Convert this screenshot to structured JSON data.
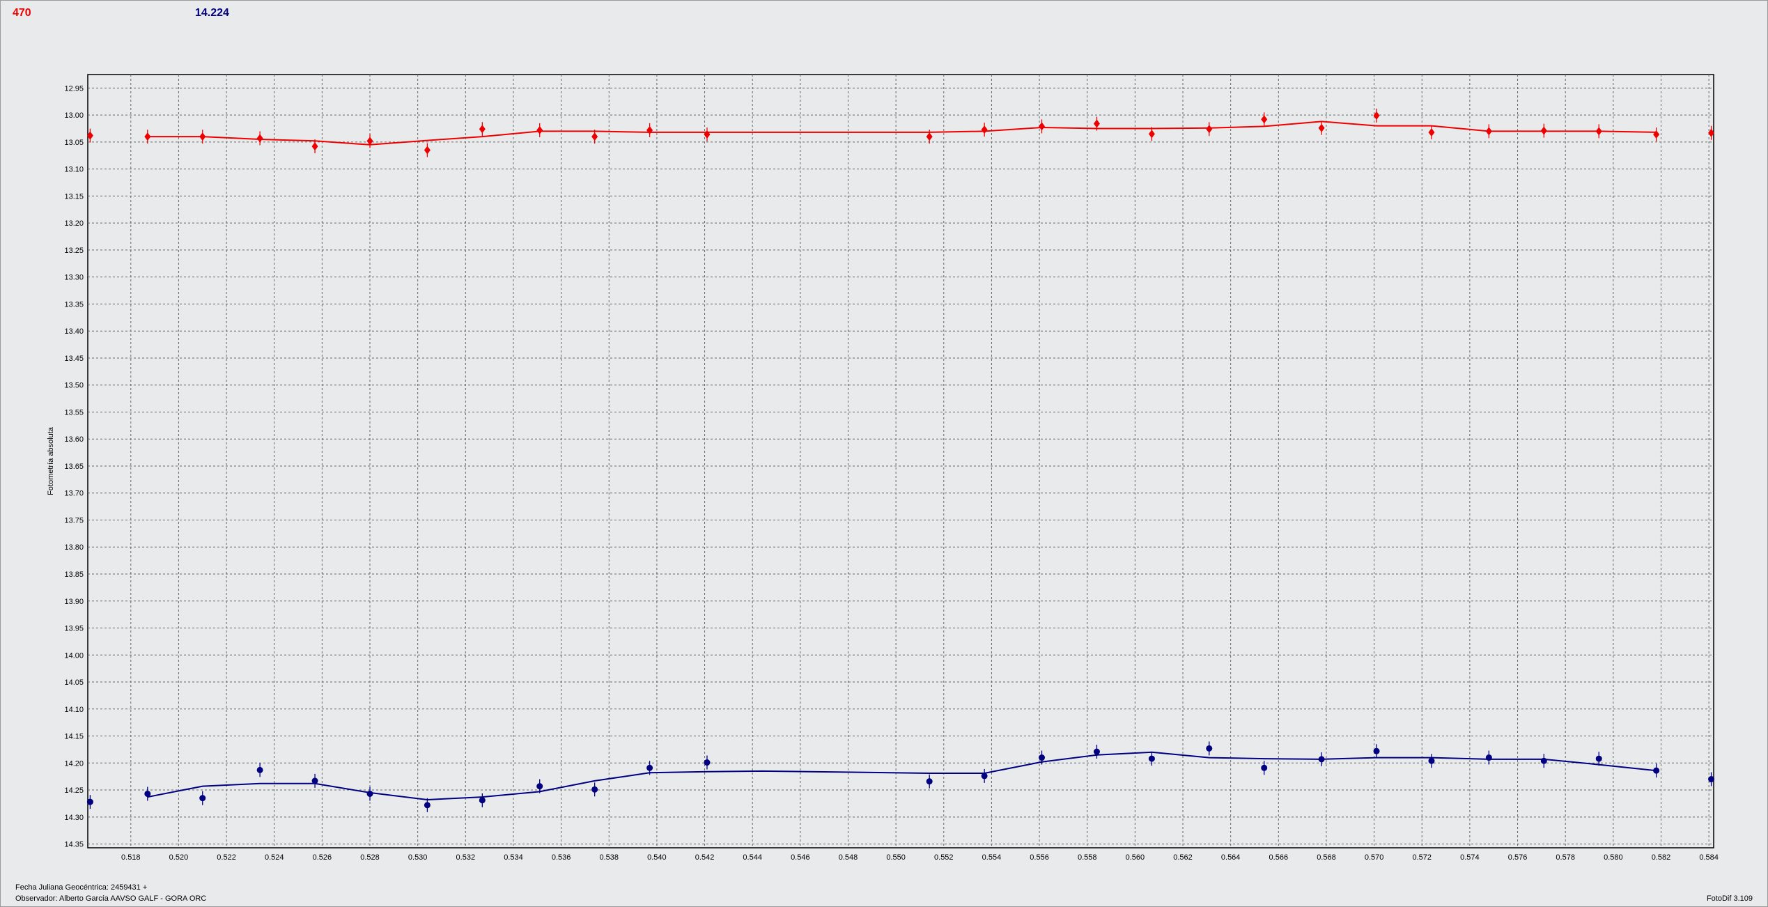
{
  "header": {
    "red_value": "470",
    "blue_value": "14.224"
  },
  "footer": {
    "jd_label": "Fecha Juliana Geocéntrica: 2459431 +",
    "observer_label": "Observador: Alberto García AAVSO GALF - GORA ORC",
    "version": "FotoDif 3.109"
  },
  "colors": {
    "red_series": "#ee0000",
    "blue_series": "#000080",
    "plot_bg": "#e9eaeb",
    "grid": "#555555"
  },
  "chart_data": {
    "type": "scatter",
    "ylabel": "Fotometría absoluta",
    "xlabel": "",
    "xlim": [
      0.5162,
      0.5842
    ],
    "ylim": [
      14.357,
      12.925
    ],
    "y_inverted": true,
    "grid": true,
    "x_ticks": [
      "0.518",
      "0.520",
      "0.522",
      "0.524",
      "0.526",
      "0.528",
      "0.530",
      "0.532",
      "0.534",
      "0.536",
      "0.538",
      "0.540",
      "0.542",
      "0.544",
      "0.546",
      "0.548",
      "0.550",
      "0.552",
      "0.554",
      "0.556",
      "0.558",
      "0.560",
      "0.562",
      "0.564",
      "0.566",
      "0.568",
      "0.570",
      "0.572",
      "0.574",
      "0.576",
      "0.578",
      "0.580",
      "0.582",
      "0.584"
    ],
    "y_ticks": [
      "12.95",
      "13.00",
      "13.05",
      "13.10",
      "13.15",
      "13.20",
      "13.25",
      "13.30",
      "13.35",
      "13.40",
      "13.45",
      "13.50",
      "13.55",
      "13.60",
      "13.65",
      "13.70",
      "13.75",
      "13.80",
      "13.85",
      "13.90",
      "13.95",
      "14.00",
      "14.05",
      "14.10",
      "14.15",
      "14.20",
      "14.25",
      "14.30",
      "14.35"
    ],
    "series": [
      {
        "color": "#ee0000",
        "marker": "diamond",
        "x": [
          0.5163,
          0.5187,
          0.521,
          0.5234,
          0.5257,
          0.528,
          0.5304,
          0.5327,
          0.5351,
          0.5374,
          0.5397,
          0.5421,
          0.5514,
          0.5537,
          0.5561,
          0.5584,
          0.5607,
          0.5631,
          0.5654,
          0.5678,
          0.5701,
          0.5724,
          0.5748,
          0.5771,
          0.5794,
          0.5818,
          0.5841
        ],
        "y": [
          13.038,
          13.04,
          13.04,
          13.043,
          13.058,
          13.048,
          13.065,
          13.026,
          13.028,
          13.04,
          13.028,
          13.036,
          13.04,
          13.027,
          13.021,
          13.016,
          13.035,
          13.026,
          13.008,
          13.024,
          13.001,
          13.032,
          13.03,
          13.029,
          13.03,
          13.036,
          13.033
        ],
        "trend_x": [
          0.5187,
          0.521,
          0.5234,
          0.5257,
          0.528,
          0.5304,
          0.5327,
          0.5351,
          0.5374,
          0.5397,
          0.5421,
          0.5514,
          0.5537,
          0.5561,
          0.5584,
          0.5607,
          0.5631,
          0.5654,
          0.5678,
          0.5701,
          0.5724,
          0.5748,
          0.5771,
          0.5794,
          0.5818
        ],
        "trend_y": [
          13.04,
          13.04,
          13.045,
          13.048,
          13.055,
          13.047,
          13.04,
          13.03,
          13.03,
          13.032,
          13.032,
          13.032,
          13.03,
          13.023,
          13.025,
          13.025,
          13.024,
          13.021,
          13.012,
          13.02,
          13.02,
          13.03,
          13.03,
          13.03,
          13.032
        ]
      },
      {
        "color": "#000080",
        "marker": "circle",
        "x": [
          0.5163,
          0.5187,
          0.521,
          0.5234,
          0.5257,
          0.528,
          0.5304,
          0.5327,
          0.5351,
          0.5374,
          0.5397,
          0.5421,
          0.5514,
          0.5537,
          0.5561,
          0.5584,
          0.5607,
          0.5631,
          0.5654,
          0.5678,
          0.5701,
          0.5724,
          0.5748,
          0.5771,
          0.5794,
          0.5818,
          0.5841
        ],
        "y": [
          14.272,
          14.257,
          14.265,
          14.213,
          14.233,
          14.257,
          14.278,
          14.269,
          14.243,
          14.249,
          14.209,
          14.199,
          14.234,
          14.224,
          14.19,
          14.179,
          14.192,
          14.173,
          14.209,
          14.193,
          14.178,
          14.196,
          14.19,
          14.196,
          14.192,
          14.214,
          14.23
        ],
        "trend_x": [
          0.5187,
          0.521,
          0.5234,
          0.5257,
          0.528,
          0.5304,
          0.5327,
          0.5351,
          0.5374,
          0.5397,
          0.5421,
          0.5444,
          0.5514,
          0.5537,
          0.5561,
          0.5584,
          0.5607,
          0.5631,
          0.5654,
          0.5678,
          0.5701,
          0.5724,
          0.5748,
          0.5771,
          0.5794,
          0.5818
        ],
        "trend_y": [
          14.263,
          14.243,
          14.238,
          14.238,
          14.255,
          14.268,
          14.263,
          14.253,
          14.233,
          14.218,
          14.216,
          14.215,
          14.219,
          14.219,
          14.198,
          14.185,
          14.18,
          14.19,
          14.192,
          14.193,
          14.19,
          14.19,
          14.193,
          14.193,
          14.203,
          14.214
        ]
      }
    ]
  }
}
